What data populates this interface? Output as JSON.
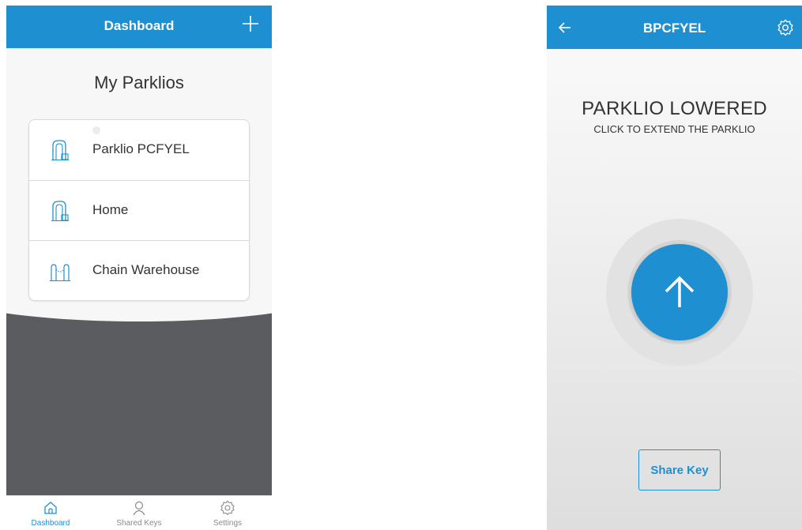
{
  "left_screen": {
    "header": {
      "title": "Dashboard",
      "add_icon": "plus-icon"
    },
    "page_title": "My Parklios",
    "devices": [
      {
        "label": "Parklio PCFYEL",
        "icon": "parklio-device-icon"
      },
      {
        "label": "Home",
        "icon": "parklio-device-icon"
      },
      {
        "label": "Chain Warehouse",
        "icon": "chain-icon"
      }
    ],
    "bottom_nav": [
      {
        "label": "Dashboard",
        "icon": "home-icon",
        "active": true
      },
      {
        "label": "Shared Keys",
        "icon": "user-icon",
        "active": false
      },
      {
        "label": "Settings",
        "icon": "gear-icon",
        "active": false
      }
    ]
  },
  "right_screen": {
    "header": {
      "title": "BPCFYEL",
      "back_icon": "back-arrow-icon",
      "settings_icon": "gear-icon"
    },
    "status_title": "PARKLIO LOWERED",
    "status_subtitle": "CLICK TO EXTEND THE PARKLIO",
    "action_icon": "arrow-up-icon",
    "share_button": "Share Key"
  },
  "colors": {
    "accent": "#1e8fd0",
    "dark_panel": "#5a5c5f",
    "text": "#333333"
  }
}
